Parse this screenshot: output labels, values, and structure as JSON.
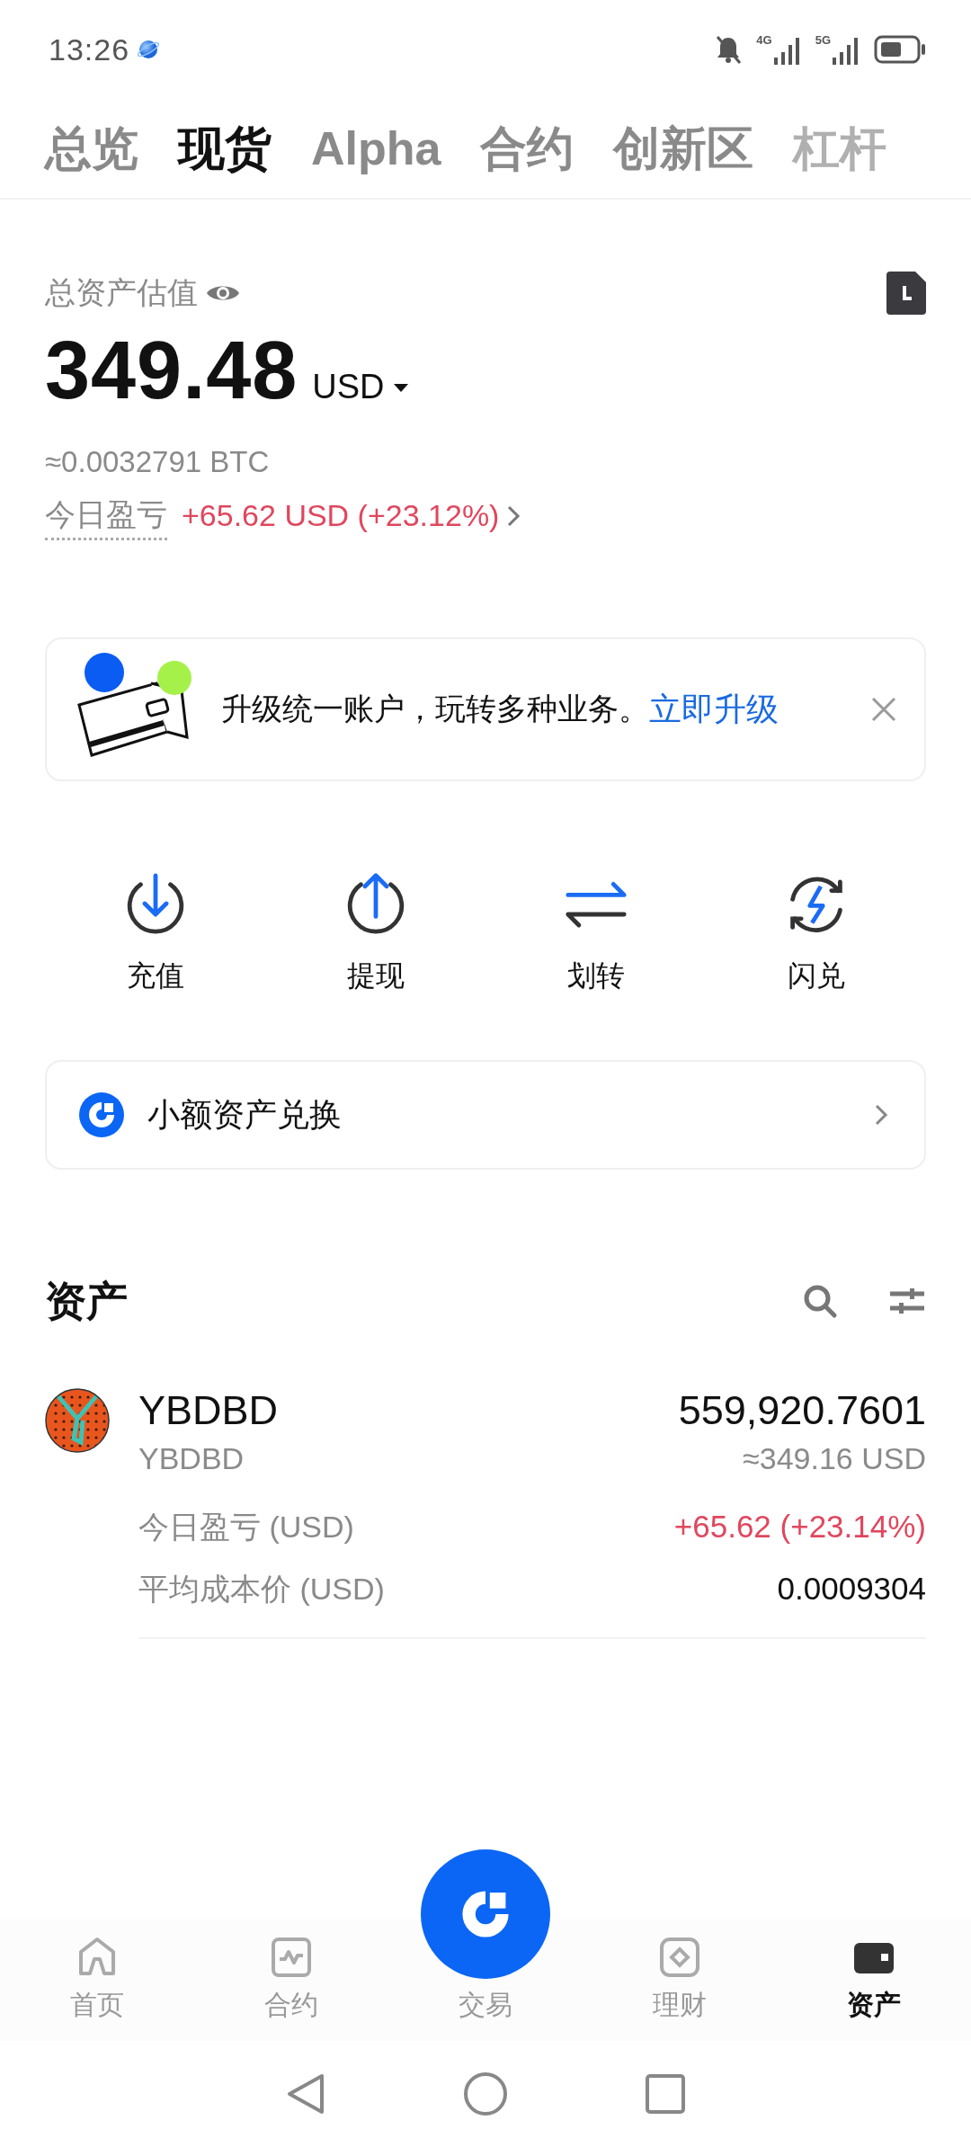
{
  "status_bar": {
    "time": "13:26",
    "network_1": "4G",
    "network_2": "5G"
  },
  "tabs": [
    {
      "label": "总览",
      "selected": false
    },
    {
      "label": "现货",
      "selected": true
    },
    {
      "label": "Alpha",
      "selected": false
    },
    {
      "label": "合约",
      "selected": false
    },
    {
      "label": "创新区",
      "selected": false
    },
    {
      "label": "杠杆",
      "selected": false
    }
  ],
  "balance": {
    "label": "总资产估值",
    "amount": "349.48",
    "currency": "USD",
    "btc": "≈0.0032791 BTC",
    "pnl_label": "今日盈亏",
    "pnl": "+65.62 USD (+23.12%)"
  },
  "banner": {
    "text": "升级统一账户，玩转多种业务。",
    "link": "立即升级"
  },
  "actions": [
    {
      "label": "充值",
      "kind": "deposit"
    },
    {
      "label": "提现",
      "kind": "withdraw"
    },
    {
      "label": "划转",
      "kind": "transfer"
    },
    {
      "label": "闪兑",
      "kind": "flash"
    }
  ],
  "dust_convert": {
    "label": "小额资产兑换"
  },
  "assets": {
    "title": "资产",
    "items": [
      {
        "symbol": "YBDBD",
        "name": "YBDBD",
        "amount": "559,920.7601",
        "value": "≈349.16 USD",
        "pnl_label": "今日盈亏 (USD)",
        "pnl": "+65.62 (+23.14%)",
        "cost_label": "平均成本价 (USD)",
        "cost": "0.0009304"
      }
    ]
  },
  "bottom_nav": [
    {
      "label": "首页",
      "kind": "home",
      "selected": false
    },
    {
      "label": "合约",
      "kind": "futures",
      "selected": false
    },
    {
      "label": "交易",
      "kind": "trade",
      "selected": false
    },
    {
      "label": "理财",
      "kind": "earn",
      "selected": false
    },
    {
      "label": "资产",
      "kind": "assets",
      "selected": true
    }
  ]
}
